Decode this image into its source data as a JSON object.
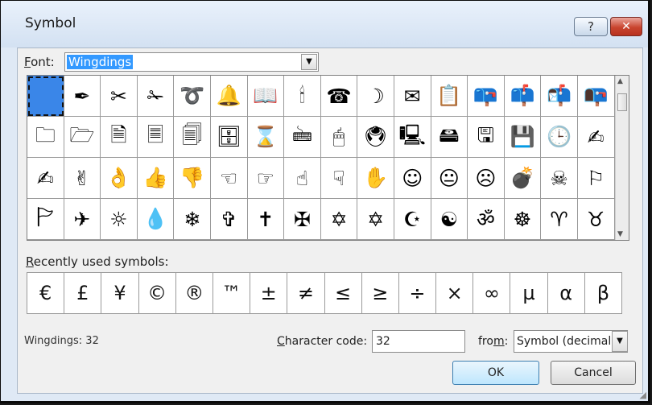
{
  "window": {
    "title": "Symbol",
    "help_label": "?",
    "close_label": "✕"
  },
  "font_row": {
    "label_first": "F",
    "label_rest": "ont:",
    "value": "Wingdings",
    "dropdown_icon": "▼"
  },
  "symbol_grid": {
    "selected_index": 0,
    "rows": [
      [
        "",
        "✒",
        "✂",
        "✁",
        "➰",
        "🔔",
        "📖",
        "🕯",
        "☎",
        "☽",
        "✉",
        "📋",
        "📪",
        "📫",
        "📬",
        "📭"
      ],
      [
        "🗀",
        "🗁",
        "🗎",
        "🗏",
        "🗐",
        "🗄",
        "⌛",
        "🖮",
        "🖱",
        "🖲",
        "🖳",
        "🖴",
        "🖫",
        "💾",
        "🕒",
        "✍"
      ],
      [
        "✍",
        "✌",
        "👌",
        "👍",
        "👎",
        "☜",
        "☞",
        "☝",
        "☟",
        "✋",
        "☺",
        "😐",
        "☹",
        "💣",
        "☠",
        "⚐"
      ],
      [
        "🏱",
        "✈",
        "☼",
        "💧",
        "❄",
        "✞",
        "✝",
        "✠",
        "✡",
        "✡",
        "☪",
        "☯",
        "ॐ",
        "☸",
        "♈",
        "♉"
      ]
    ],
    "scroll_up_icon": "▲",
    "scroll_down_icon": "▼"
  },
  "recent": {
    "label_first": "R",
    "label_rest": "ecently used symbols:",
    "symbols": [
      "€",
      "£",
      "¥",
      "©",
      "®",
      "™",
      "±",
      "≠",
      "≤",
      "≥",
      "÷",
      "×",
      "∞",
      "µ",
      "α",
      "β"
    ]
  },
  "status": {
    "text": "Wingdings: 32"
  },
  "char_code": {
    "label_first": "C",
    "label_rest": "haracter code:",
    "value": "32"
  },
  "from": {
    "label_start": "fro",
    "label_u": "m",
    "label_end": ":",
    "value": "Symbol (decimal)",
    "dropdown_icon": "▼"
  },
  "buttons": {
    "ok": "OK",
    "cancel": "Cancel"
  },
  "colors": {
    "selection": "#3a86e8",
    "font_highlight": "#3399ff",
    "close_button": "#c9442f",
    "dialog_background": "#f0f0f0"
  }
}
